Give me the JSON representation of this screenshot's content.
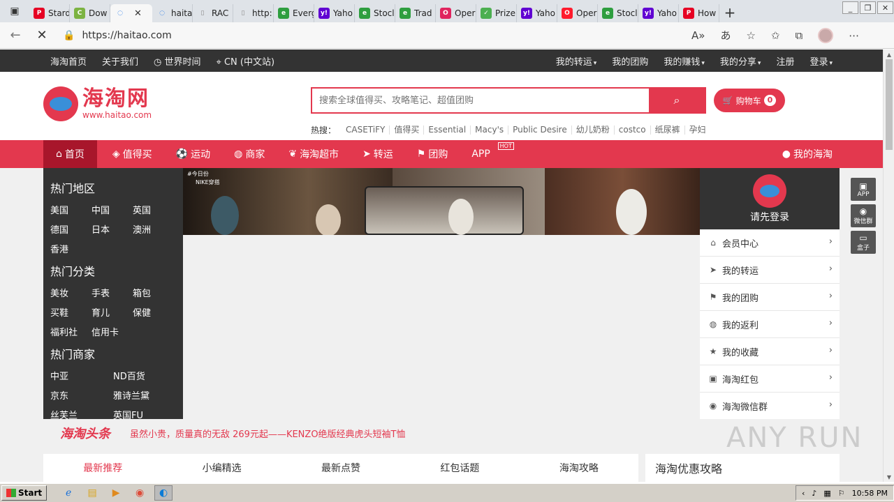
{
  "browser": {
    "tabs": [
      {
        "label": "Stard",
        "icon": "pinterest-icon",
        "color": "#e60023"
      },
      {
        "label": "Dow",
        "icon": "c-icon",
        "color": "#7cb342"
      },
      {
        "label": "",
        "icon": "loading-icon",
        "color": "#1a73e8",
        "active": true
      },
      {
        "label": "haita",
        "icon": "loading-icon",
        "color": "#1a73e8"
      },
      {
        "label": "RAC",
        "icon": "page-icon",
        "color": "#888"
      },
      {
        "label": "http:",
        "icon": "page-icon",
        "color": "#888"
      },
      {
        "label": "Everg",
        "icon": "evergreen-icon",
        "color": "#2e9e3f"
      },
      {
        "label": "Yaho",
        "icon": "yahoo-icon",
        "color": "#6001d2"
      },
      {
        "label": "Stocl",
        "icon": "evergreen-icon",
        "color": "#2e9e3f"
      },
      {
        "label": "Trad",
        "icon": "evergreen-icon",
        "color": "#2e9e3f"
      },
      {
        "label": "Oper",
        "icon": "opera-icon",
        "color": "#e0245e"
      },
      {
        "label": "Prize",
        "icon": "check-icon",
        "color": "#4caf50"
      },
      {
        "label": "Yaho",
        "icon": "yahoo-icon",
        "color": "#6001d2"
      },
      {
        "label": "Oper",
        "icon": "opera-icon",
        "color": "#ff1b2d"
      },
      {
        "label": "Stocl",
        "icon": "evergreen-icon",
        "color": "#2e9e3f"
      },
      {
        "label": "Yaho",
        "icon": "yahoo-icon",
        "color": "#6001d2"
      },
      {
        "label": "How",
        "icon": "pinterest-icon",
        "color": "#e60023"
      }
    ],
    "url": "https://haitao.com"
  },
  "topnav": {
    "left": [
      "海淘首页",
      "关于我们",
      "世界时间",
      "CN (中文站)"
    ],
    "right": [
      "我的转运",
      "我的团购",
      "我的赚钱",
      "我的分享",
      "注册",
      "登录"
    ]
  },
  "logo": {
    "title": "海淘网",
    "url": "www.haitao.com"
  },
  "search": {
    "placeholder": "搜索全球值得买、攻略笔记、超值团购"
  },
  "cart": {
    "label": "购物车",
    "count": "0"
  },
  "hot": {
    "label": "热搜：",
    "items": [
      "CASETiFY",
      "值得买",
      "Essential",
      "Macy's",
      "Public Desire",
      "幼儿奶粉",
      "costco",
      "纸尿裤",
      "孕妇"
    ]
  },
  "mainnav": {
    "items": [
      "首页",
      "值得买",
      "运动",
      "商家",
      "海淘超市",
      "转运",
      "团购",
      "APP"
    ],
    "app_badge": "HOT",
    "my": "我的海淘"
  },
  "sidebar": {
    "regions_title": "热门地区",
    "regions": [
      "美国",
      "中国",
      "英国",
      "德国",
      "日本",
      "澳洲",
      "香港"
    ],
    "cats_title": "热门分类",
    "cats": [
      "美妆",
      "手表",
      "箱包",
      "买鞋",
      "育儿",
      "保健",
      "福利社",
      "信用卡"
    ],
    "stores_title": "热门商家",
    "stores": [
      "中亚",
      "ND百货",
      "京东",
      "雅诗兰黛",
      "丝芙兰",
      "英国FU"
    ]
  },
  "banner": {
    "tag": "#今日份",
    "brand": "NIKE穿搭"
  },
  "user": {
    "login": "请先登录",
    "items": [
      "会员中心",
      "我的转运",
      "我的团购",
      "我的返利",
      "我的收藏",
      "海淘红包",
      "海淘微信群"
    ]
  },
  "floaters": [
    "APP",
    "微信群",
    "盒子"
  ],
  "headline": {
    "title": "海淘头条",
    "text": "虽然小贵，质量真的无敌 269元起——KENZO绝版经典虎头短袖T恤"
  },
  "tabs": [
    "最新推荐",
    "小编精选",
    "最新点赞",
    "红包话题",
    "海淘攻略"
  ],
  "promo": "海淘优惠攻略",
  "watermark": "ANY RUN",
  "taskbar": {
    "start": "Start",
    "time": "10:58 PM"
  },
  "colors": {
    "brand": "#e3384e",
    "dark": "#333333"
  }
}
